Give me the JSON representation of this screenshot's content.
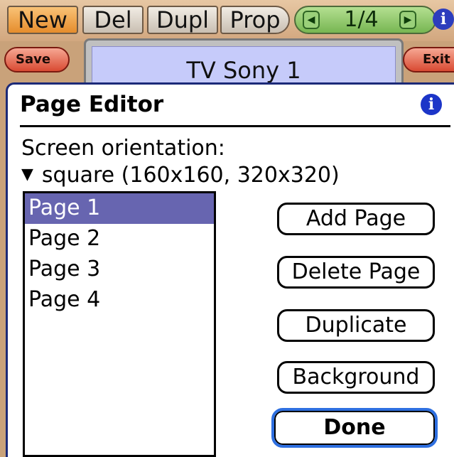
{
  "toolbar": {
    "new_label": "New",
    "del_label": "Del",
    "dupl_label": "Dupl",
    "prop_label": "Prop",
    "pager_count": "1/4",
    "info_label": "i"
  },
  "titlebar": {
    "save_label": "Save",
    "device_name": "TV Sony 1",
    "exit_label": "Exit"
  },
  "dialog": {
    "title": "Page Editor",
    "info_label": "i",
    "orientation_label": "Screen orientation:",
    "orientation_value": "square (160x160, 320x320)",
    "pages": [
      "Page 1",
      "Page 2",
      "Page 3",
      "Page 4"
    ],
    "selected_page": "Page 1",
    "buttons": {
      "add": "Add Page",
      "delete": "Delete Page",
      "duplicate": "Duplicate",
      "background": "Background",
      "done": "Done"
    }
  }
}
